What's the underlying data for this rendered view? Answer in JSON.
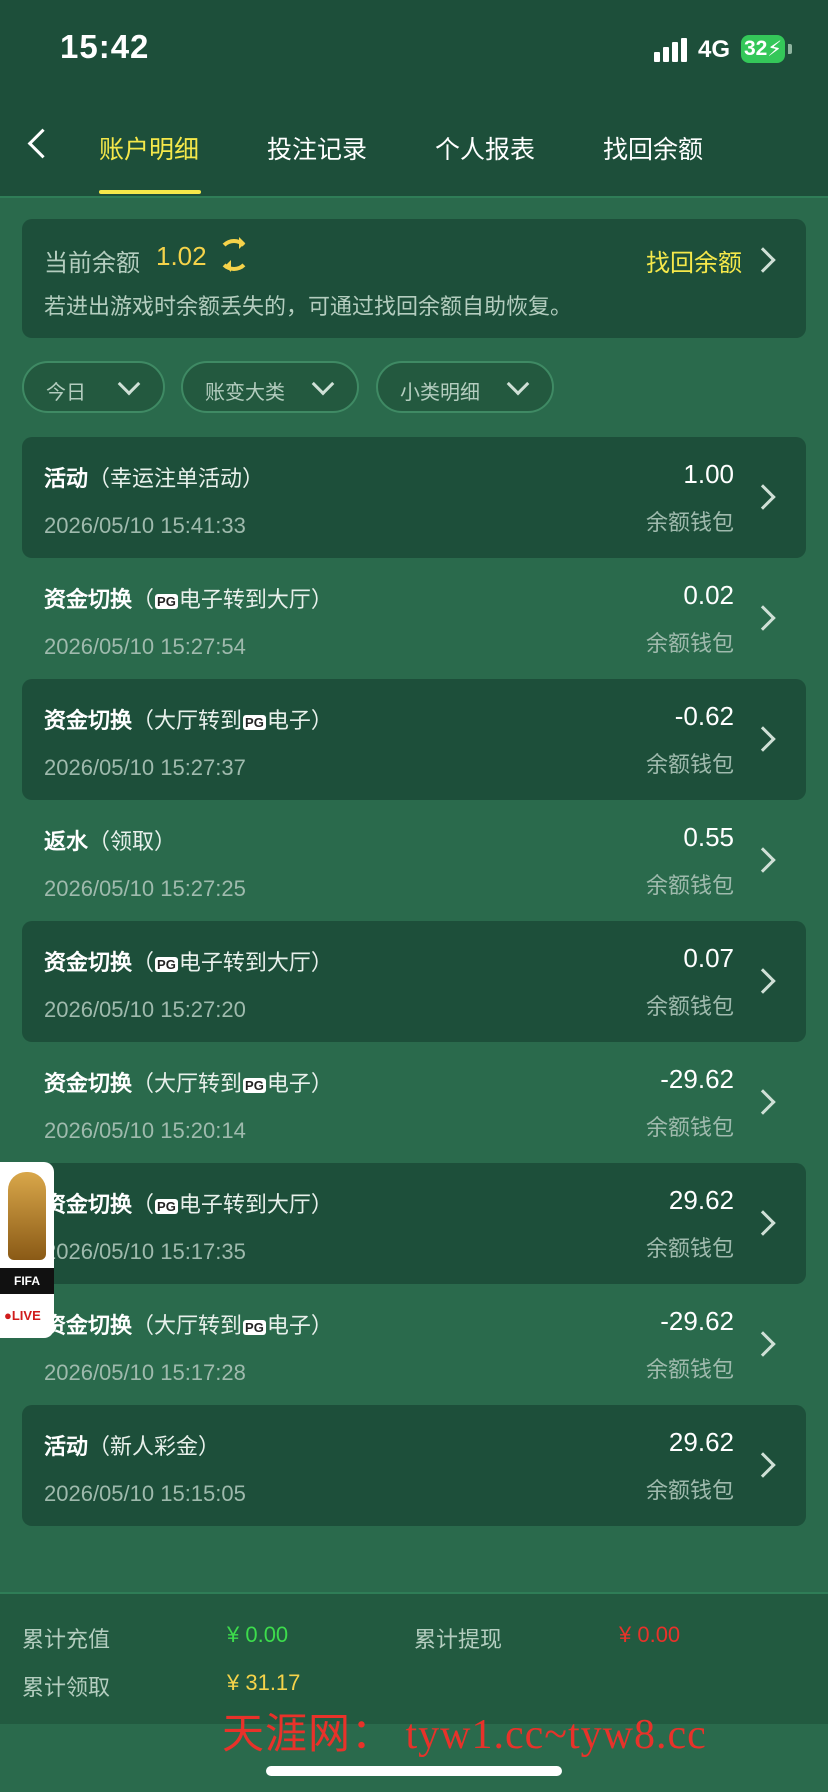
{
  "status_bar": {
    "time": "15:42",
    "network": "4G",
    "battery": "32"
  },
  "nav": {
    "tabs": [
      {
        "label": "账户明细",
        "active": true
      },
      {
        "label": "投注记录",
        "active": false
      },
      {
        "label": "个人报表",
        "active": false
      },
      {
        "label": "找回余额",
        "active": false
      }
    ]
  },
  "balance_card": {
    "label": "当前余额",
    "value": "1.02",
    "recover_label": "找回余额",
    "hint": "若进出游戏时余额丢失的，可通过找回余额自助恢复。"
  },
  "filters": [
    {
      "label": "今日"
    },
    {
      "label": "账变大类"
    },
    {
      "label": "小类明细"
    }
  ],
  "transactions": [
    {
      "type": "活动",
      "detail_pre": "（幸运注单活动）",
      "detail_post": "",
      "time": "2026/05/10 15:41:33",
      "amount": "1.00",
      "wallet": "余额钱包"
    },
    {
      "type": "资金切换",
      "detail_pre": "（",
      "pg": "PG",
      "detail_post": "电子转到大厅）",
      "time": "2026/05/10 15:27:54",
      "amount": "0.02",
      "wallet": "余额钱包"
    },
    {
      "type": "资金切换",
      "detail_pre": "（大厅转到",
      "pg": "PG",
      "detail_post": "电子）",
      "time": "2026/05/10 15:27:37",
      "amount": "-0.62",
      "wallet": "余额钱包"
    },
    {
      "type": "返水",
      "detail_pre": "（领取）",
      "detail_post": "",
      "time": "2026/05/10 15:27:25",
      "amount": "0.55",
      "wallet": "余额钱包"
    },
    {
      "type": "资金切换",
      "detail_pre": "（",
      "pg": "PG",
      "detail_post": "电子转到大厅）",
      "time": "2026/05/10 15:27:20",
      "amount": "0.07",
      "wallet": "余额钱包"
    },
    {
      "type": "资金切换",
      "detail_pre": "（大厅转到",
      "pg": "PG",
      "detail_post": "电子）",
      "time": "2026/05/10 15:20:14",
      "amount": "-29.62",
      "wallet": "余额钱包"
    },
    {
      "type": "资金切换",
      "detail_pre": "（",
      "pg": "PG",
      "detail_post": "电子转到大厅）",
      "time": "2026/05/10 15:17:35",
      "amount": "29.62",
      "wallet": "余额钱包"
    },
    {
      "type": "资金切换",
      "detail_pre": "（大厅转到",
      "pg": "PG",
      "detail_post": "电子）",
      "time": "2026/05/10 15:17:28",
      "amount": "-29.62",
      "wallet": "余额钱包"
    },
    {
      "type": "活动",
      "detail_pre": "（新人彩金）",
      "detail_post": "",
      "time": "2026/05/10 15:15:05",
      "amount": "29.62",
      "wallet": "余额钱包"
    }
  ],
  "summary": {
    "total_deposit_label": "累计充值",
    "total_deposit": "¥ 0.00",
    "total_withdraw_label": "累计提现",
    "total_withdraw": "¥ 0.00",
    "total_claimed_label": "累计领取",
    "total_claimed": "¥ 31.17"
  },
  "watermark": "天涯网： tyw1.cc~tyw8.cc",
  "fifa_badge": {
    "text": "FIFA",
    "live": "●LIVE"
  },
  "colors": {
    "background": "#2a6a4c",
    "panel": "#1d4f3a",
    "accent_yellow": "#f5e84a",
    "amount_gold": "#f5d34a",
    "deposit_green": "#3ddc4c",
    "withdraw_red": "#e8322a"
  }
}
